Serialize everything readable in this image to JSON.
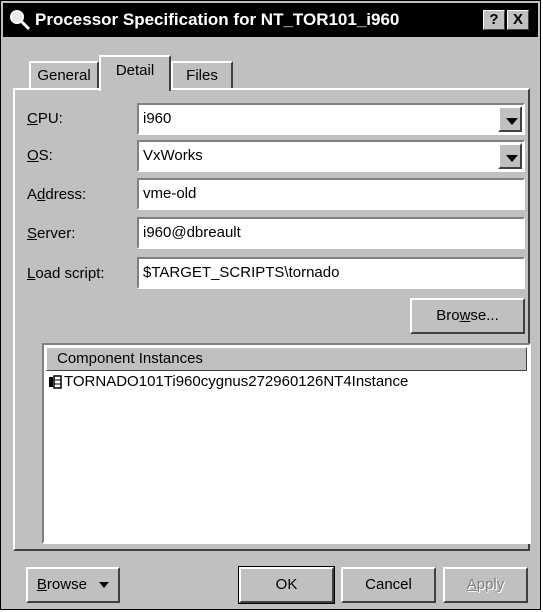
{
  "window": {
    "title": "Processor Specification for NT_TOR101_i960",
    "help_label": "?",
    "close_label": "X"
  },
  "tabs": [
    {
      "label": "General",
      "active": false
    },
    {
      "label": "Detail",
      "active": true
    },
    {
      "label": "Files",
      "active": false
    }
  ],
  "fields": {
    "cpu": {
      "label_mnemonic": "C",
      "label_rest": "PU:",
      "value": "i960"
    },
    "os": {
      "label_mnemonic": "O",
      "label_rest": "S:",
      "value": "VxWorks"
    },
    "address": {
      "label_pre": "A",
      "label_mnemonic": "d",
      "label_rest": "dress:",
      "value": "vme-old"
    },
    "server": {
      "label_mnemonic": "S",
      "label_rest": "erver:",
      "value": "i960@dbreault"
    },
    "load_script": {
      "label_mnemonic": "L",
      "label_rest": "oad script:",
      "value": "$TARGET_SCRIPTS\\tornado"
    }
  },
  "browse_field_button": {
    "pre": "Bro",
    "mnemonic": "w",
    "rest": "se..."
  },
  "component_list": {
    "header": "Component Instances",
    "items": [
      "TORNADO101Ti960cygnus272960126NT4Instance"
    ]
  },
  "footer": {
    "browse": {
      "mnemonic": "B",
      "rest": "rowse"
    },
    "ok": "OK",
    "cancel": "Cancel",
    "apply": {
      "mnemonic": "A",
      "rest": "pply"
    }
  }
}
